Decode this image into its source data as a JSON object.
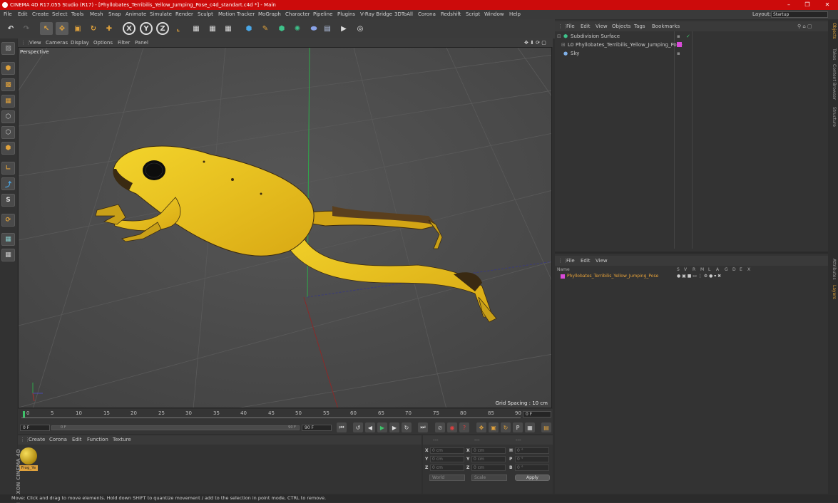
{
  "window": {
    "title": "CINEMA 4D R17.055 Studio (R17) - [Phyllobates_Terribilis_Yellow_Jumping_Pose_c4d_standart.c4d *] - Main",
    "controls": [
      "–",
      "❐",
      "✕"
    ]
  },
  "menubar": {
    "items": [
      "File",
      "Edit",
      "Create",
      "Select",
      "Tools",
      "Mesh",
      "Snap",
      "Animate",
      "Simulate",
      "Render",
      "Sculpt",
      "Motion Tracker",
      "MoGraph",
      "Character",
      "Pipeline",
      "Plugins",
      "V-Ray Bridge",
      "3DToAll",
      "Corona",
      "Redshift",
      "Script",
      "Window",
      "Help"
    ],
    "layout_label": "Layout:",
    "layout_value": "Startup"
  },
  "toolbar": {
    "axis_x": "X",
    "axis_y": "Y",
    "axis_z": "Z"
  },
  "viewport": {
    "menu": [
      "View",
      "Cameras",
      "Display",
      "Options",
      "Filter",
      "Panel"
    ],
    "label": "Perspective",
    "grid_spacing": "Grid Spacing : 10 cm"
  },
  "timeline": {
    "ticks": [
      "0",
      "5",
      "10",
      "15",
      "20",
      "25",
      "30",
      "35",
      "40",
      "45",
      "50",
      "55",
      "60",
      "65",
      "70",
      "75",
      "80",
      "85",
      "90"
    ],
    "end_field": "0 F",
    "current_frame": "0 F",
    "range_start": "0 F",
    "range_end": "90 F",
    "max_frame": "90 F"
  },
  "material_panel": {
    "menu": [
      "Create",
      "Corona",
      "Edit",
      "Function",
      "Texture"
    ],
    "material_name": "Frog_Ye"
  },
  "coord_panel": {
    "header": [
      "---",
      "---",
      "---"
    ],
    "rows": [
      {
        "a": "X",
        "av": "0 cm",
        "b": "X",
        "bv": "0 cm",
        "c": "H",
        "cv": "0 °"
      },
      {
        "a": "Y",
        "av": "0 cm",
        "b": "Y",
        "bv": "0 cm",
        "c": "P",
        "cv": "0 °"
      },
      {
        "a": "Z",
        "av": "0 cm",
        "b": "Z",
        "bv": "0 cm",
        "c": "B",
        "cv": "0 °"
      }
    ],
    "world": "World",
    "scale": "Scale",
    "apply": "Apply"
  },
  "object_manager": {
    "menu": [
      "File",
      "Edit",
      "View",
      "Objects",
      "Tags",
      "Bookmarks"
    ],
    "objects": [
      {
        "name": "Subdivision Surface",
        "indent": 0
      },
      {
        "name": "Phyllobates_Terribilis_Yellow_Jumping_Pose",
        "indent": 1
      },
      {
        "name": "Sky",
        "indent": 0
      }
    ]
  },
  "layer_manager": {
    "menu": [
      "File",
      "Edit",
      "View"
    ],
    "col_name": "Name",
    "cols": [
      "S",
      "V",
      "R",
      "M",
      "L",
      "A",
      "G",
      "D",
      "E",
      "X"
    ],
    "row": "Phyllobates_Terribilis_Yellow_Jumping_Pose"
  },
  "side_tabs": [
    "Objects",
    "Takes",
    "Content Browser",
    "Structure"
  ],
  "side_tabs_lower": [
    "Attributes",
    "Layers"
  ],
  "branding": "MAXON CINEMA 4D",
  "status": "Move: Click and drag to move elements. Hold down SHIFT to quantize movement / add to the selection in point mode, CTRL to remove.",
  "colors": {
    "titlebar": "#cc0b0b",
    "frog": "#e9c21f",
    "layer_text": "#e6a23a",
    "accent": "#e0a23c"
  }
}
